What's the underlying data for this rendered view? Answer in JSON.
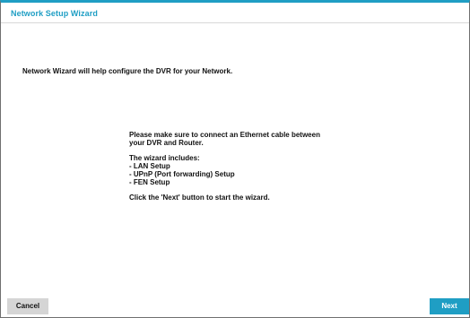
{
  "window": {
    "title": "Network Setup Wizard"
  },
  "content": {
    "intro": "Network Wizard will help configure the DVR for your Network.",
    "instructions": [
      "Please make sure to connect an Ethernet cable between",
      "your DVR and Router.",
      "",
      "The wizard includes:",
      "- LAN Setup",
      "- UPnP (Port forwarding) Setup",
      "- FEN Setup",
      "",
      "Click the 'Next' button to start the wizard."
    ]
  },
  "footer": {
    "cancel_label": "Cancel",
    "next_label": "Next"
  },
  "colors": {
    "accent": "#1f9ec4",
    "cancel_bg": "#d5d5d5",
    "text": "#111111"
  }
}
